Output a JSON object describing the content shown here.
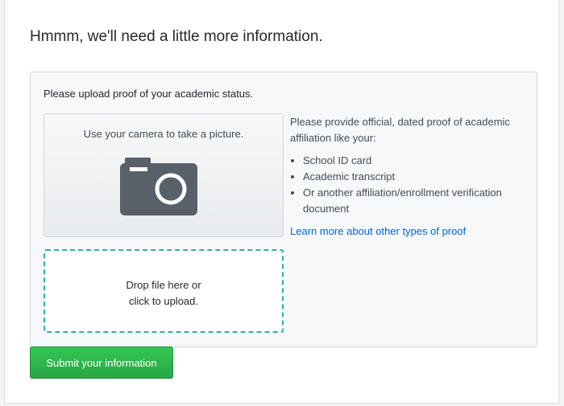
{
  "page": {
    "heading": "Hmmm, we'll need a little more information."
  },
  "upload_panel": {
    "title": "Please upload proof of your academic status.",
    "camera": {
      "text": "Use your camera to take a picture.",
      "icon": "camera-icon"
    },
    "dropzone": {
      "line1": "Drop file here or",
      "line2": "click to upload."
    },
    "info": {
      "intro": "Please provide official, dated proof of academic affiliation like your:",
      "items": [
        "School ID card",
        "Academic transcript",
        "Or another affiliation/enrollment verification document"
      ],
      "link": "Learn more about other types of proof"
    }
  },
  "actions": {
    "submit_label": "Submit your information"
  },
  "colors": {
    "accent_green": "#28a745",
    "link_blue": "#0366d6",
    "dropzone_border": "#2db39e",
    "camera_icon": "#586069"
  }
}
